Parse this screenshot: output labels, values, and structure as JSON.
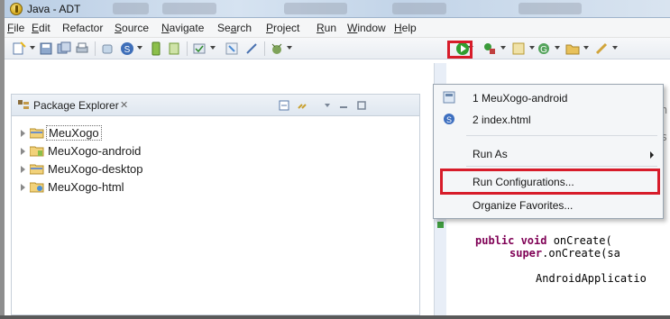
{
  "window": {
    "title": "Java - ADT"
  },
  "menubar": {
    "items": [
      {
        "label": "File",
        "mnemonic_index": 0
      },
      {
        "label": "Edit",
        "mnemonic_index": 0
      },
      {
        "label": "Refactor",
        "mnemonic_index": -1
      },
      {
        "label": "Source",
        "mnemonic_index": 0
      },
      {
        "label": "Navigate",
        "mnemonic_index": 0
      },
      {
        "label": "Search",
        "mnemonic_index": 2
      },
      {
        "label": "Project",
        "mnemonic_index": 0
      },
      {
        "label": "Run",
        "mnemonic_index": 0
      },
      {
        "label": "Window",
        "mnemonic_index": 0
      },
      {
        "label": "Help",
        "mnemonic_index": 0
      }
    ]
  },
  "package_explorer": {
    "title": "Package Explorer",
    "close_glyph": "✕",
    "projects": [
      {
        "label": "MeuXogo",
        "selected": true
      },
      {
        "label": "MeuXogo-android",
        "selected": false
      },
      {
        "label": "MeuXogo-desktop",
        "selected": false
      },
      {
        "label": "MeuXogo-html",
        "selected": false
      }
    ]
  },
  "run_dropdown": {
    "items": [
      {
        "label": "1 MeuXogo-android",
        "icon": "android-app-icon"
      },
      {
        "label": "2 index.html",
        "icon": "web-page-icon"
      },
      {
        "label": "Run As",
        "icon": "",
        "submenu": true
      },
      {
        "label": "Run Configurations...",
        "icon": "",
        "highlighted": true
      },
      {
        "label": "Organize Favorites...",
        "icon": ""
      }
    ]
  },
  "editor": {
    "lines": [
      {
        "keyword": "public void",
        "rest": " onCreate("
      },
      {
        "keyword": "super",
        "rest": ".onCreate(sa"
      },
      {
        "keyword": "",
        "rest": "AndroidApplicatio"
      }
    ]
  },
  "colors": {
    "highlight_red": "#d71c2a",
    "keyword_purple": "#7f0055",
    "run_green": "#2f9e2f"
  }
}
